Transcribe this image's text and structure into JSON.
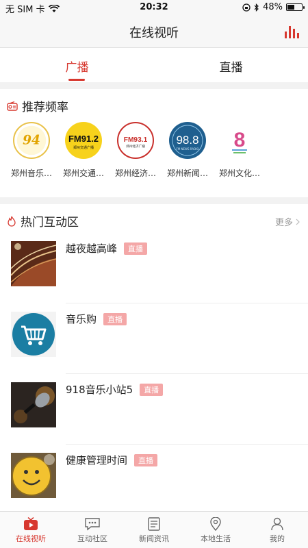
{
  "status": {
    "carrier": "无 SIM 卡",
    "time": "20:32",
    "battery": "48%",
    "battery_level": 0.48
  },
  "nav": {
    "title": "在线视听",
    "right_icon": "equalizer-icon"
  },
  "tabs": [
    {
      "label": "广播",
      "active": true
    },
    {
      "label": "直播",
      "active": false
    }
  ],
  "recommended": {
    "title": "推荐频率",
    "icon": "radio-icon",
    "items": [
      {
        "name": "郑州音乐…",
        "logo_text": "94",
        "logo_sub": ""
      },
      {
        "name": "郑州交通…",
        "logo_text": "FM91.2",
        "logo_sub": "郑州交通广播"
      },
      {
        "name": "郑州经济…",
        "logo_text": "FM93.1",
        "logo_sub": "郑州经济广播"
      },
      {
        "name": "郑州新闻…",
        "logo_text": "98.8",
        "logo_sub": "FM NEWS RADIO"
      },
      {
        "name": "郑州文化…",
        "logo_text": "8",
        "logo_sub": ""
      }
    ]
  },
  "hot": {
    "title": "热门互动区",
    "icon": "flame-icon",
    "more_label": "更多",
    "badge_label": "直播",
    "items": [
      {
        "title": "越夜越高峰",
        "thumb": "concert-hall-thumb"
      },
      {
        "title": "音乐购",
        "thumb": "shopping-cart-thumb"
      },
      {
        "title": "918音乐小站5",
        "thumb": "microphone-thumb"
      },
      {
        "title": "健康管理时间",
        "thumb": "clock-thumb"
      }
    ]
  },
  "tabbar": [
    {
      "label": "在线视听",
      "icon": "tv-play-icon",
      "active": true
    },
    {
      "label": "互动社区",
      "icon": "chat-icon",
      "active": false
    },
    {
      "label": "新闻资讯",
      "icon": "news-icon",
      "active": false
    },
    {
      "label": "本地生活",
      "icon": "location-icon",
      "active": false
    },
    {
      "label": "我的",
      "icon": "user-icon",
      "active": false
    }
  ],
  "colors": {
    "accent": "#d7382f",
    "badge": "#f4a7a7"
  }
}
